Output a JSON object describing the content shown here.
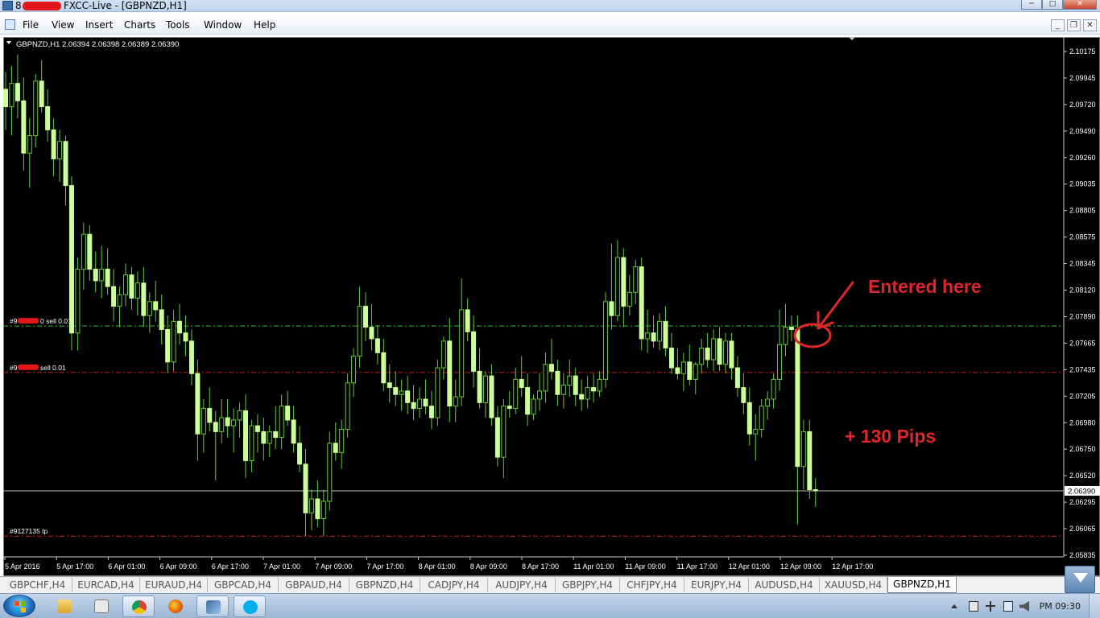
{
  "window": {
    "title_prefix": "8",
    "title_text": "FXCC-Live - [GBPNZD,H1]",
    "minimize": "─",
    "maximize": "□",
    "close": "✕"
  },
  "menu": {
    "items": [
      "File",
      "View",
      "Insert",
      "Charts",
      "Tools",
      "Window",
      "Help"
    ],
    "mdi_buttons": [
      "_",
      "❐",
      "✕"
    ]
  },
  "chart": {
    "header": "GBPNZD,H1  2.06394 2.06398 2.06389 2.06390",
    "price_ticks": [
      "2.10175",
      "2.09945",
      "2.09720",
      "2.09490",
      "2.09260",
      "2.09035",
      "2.08805",
      "2.08575",
      "2.08345",
      "2.08120",
      "2.07890",
      "2.07665",
      "2.07435",
      "2.07205",
      "2.06980",
      "2.06750",
      "2.06520",
      "2.06295",
      "2.06065",
      "2.05835"
    ],
    "time_ticks": [
      "5 Apr 2016",
      "5 Apr 17:00",
      "6 Apr 01:00",
      "6 Apr 09:00",
      "6 Apr 17:00",
      "7 Apr 01:00",
      "7 Apr 09:00",
      "7 Apr 17:00",
      "8 Apr 01:00",
      "8 Apr 09:00",
      "8 Apr 17:00",
      "11 Apr 01:00",
      "11 Apr 09:00",
      "11 Apr 17:00",
      "12 Apr 01:00",
      "12 Apr 09:00",
      "12 Apr 17:00"
    ],
    "current_price": "2.06390",
    "order_lines": [
      {
        "label_prefix": "#9",
        "label_suffix": "0 sell 0.01",
        "color": "#34c234",
        "price": 2.0781
      },
      {
        "label_prefix": "#9",
        "label_suffix": "sell 0.01",
        "color": "#d42020",
        "price": 2.0741
      },
      {
        "label_prefix": "#9127135 tp",
        "label_suffix": "",
        "color": "#d42020",
        "price": 2.06
      }
    ],
    "annotations": {
      "entered": "Entered here",
      "pips": "+ 130 Pips",
      "color": "#e0262b"
    },
    "candle_color": "#ccff99",
    "wick_color": "#66cc33"
  },
  "chart_data": {
    "type": "candlestick",
    "title": "GBPNZD,H1",
    "ylim": [
      2.05835,
      2.10175
    ],
    "candles": [
      [
        2.0985,
        2.1,
        2.095,
        2.097
      ],
      [
        2.097,
        2.1005,
        2.0945,
        2.099
      ],
      [
        2.099,
        2.1015,
        2.096,
        2.0975
      ],
      [
        2.0975,
        2.0995,
        2.0915,
        2.093
      ],
      [
        2.093,
        2.096,
        2.09,
        2.0945
      ],
      [
        2.0945,
        2.0998,
        2.0935,
        2.0992
      ],
      [
        2.0992,
        2.101,
        2.0965,
        2.097
      ],
      [
        2.097,
        2.0985,
        2.094,
        2.095
      ],
      [
        2.095,
        2.096,
        2.091,
        2.0925
      ],
      [
        2.0925,
        2.095,
        2.0905,
        2.094
      ],
      [
        2.094,
        2.0945,
        2.0885,
        2.0902
      ],
      [
        2.0902,
        2.091,
        2.076,
        2.0775
      ],
      [
        2.0775,
        2.084,
        2.076,
        2.083
      ],
      [
        2.083,
        2.087,
        2.0812,
        2.086
      ],
      [
        2.086,
        2.0868,
        2.082,
        2.083
      ],
      [
        2.083,
        2.0845,
        2.081,
        2.082
      ],
      [
        2.082,
        2.085,
        2.0805,
        2.083
      ],
      [
        2.083,
        2.0848,
        2.0808,
        2.0815
      ],
      [
        2.0815,
        2.083,
        2.0785,
        2.0798
      ],
      [
        2.0798,
        2.0815,
        2.078,
        2.0808
      ],
      [
        2.0808,
        2.0835,
        2.0798,
        2.0825
      ],
      [
        2.0825,
        2.0832,
        2.0795,
        2.0805
      ],
      [
        2.0805,
        2.0828,
        2.079,
        2.0818
      ],
      [
        2.0818,
        2.0832,
        2.078,
        2.079
      ],
      [
        2.079,
        2.081,
        2.0775,
        2.0802
      ],
      [
        2.0802,
        2.082,
        2.0785,
        2.0795
      ],
      [
        2.0795,
        2.0808,
        2.0765,
        2.0778
      ],
      [
        2.0778,
        2.079,
        2.074,
        2.075
      ],
      [
        2.075,
        2.0795,
        2.0742,
        2.0785
      ],
      [
        2.0785,
        2.08,
        2.0765,
        2.0775
      ],
      [
        2.0775,
        2.079,
        2.0755,
        2.0768
      ],
      [
        2.0768,
        2.0778,
        2.073,
        2.074
      ],
      [
        2.074,
        2.0752,
        2.0665,
        2.0688
      ],
      [
        2.0688,
        2.0718,
        2.0672,
        2.071
      ],
      [
        2.071,
        2.0728,
        2.069,
        2.0698
      ],
      [
        2.0698,
        2.0708,
        2.0648,
        2.069
      ],
      [
        2.069,
        2.0718,
        2.068,
        2.0702
      ],
      [
        2.0702,
        2.0718,
        2.0685,
        2.0695
      ],
      [
        2.0695,
        2.071,
        2.0672,
        2.07
      ],
      [
        2.07,
        2.0715,
        2.0685,
        2.0708
      ],
      [
        2.0708,
        2.0722,
        2.065,
        2.0665
      ],
      [
        2.0665,
        2.07,
        2.0655,
        2.0695
      ],
      [
        2.0695,
        2.0705,
        2.0672,
        2.069
      ],
      [
        2.069,
        2.0702,
        2.0665,
        2.068
      ],
      [
        2.068,
        2.0695,
        2.0668,
        2.069
      ],
      [
        2.069,
        2.0712,
        2.0675,
        2.0685
      ],
      [
        2.0685,
        2.0722,
        2.0675,
        2.0712
      ],
      [
        2.0712,
        2.0725,
        2.0695,
        2.07
      ],
      [
        2.07,
        2.0712,
        2.0672,
        2.068
      ],
      [
        2.068,
        2.0695,
        2.0655,
        2.0662
      ],
      [
        2.0662,
        2.0675,
        2.06,
        2.062
      ],
      [
        2.062,
        2.064,
        2.0605,
        2.0632
      ],
      [
        2.0632,
        2.0648,
        2.0608,
        2.0615
      ],
      [
        2.0615,
        2.064,
        2.06,
        2.063
      ],
      [
        2.063,
        2.069,
        2.0622,
        2.068
      ],
      [
        2.068,
        2.0698,
        2.0665,
        2.0672
      ],
      [
        2.0672,
        2.07,
        2.0658,
        2.0692
      ],
      [
        2.0692,
        2.074,
        2.0685,
        2.0732
      ],
      [
        2.0732,
        2.0762,
        2.072,
        2.0755
      ],
      [
        2.0755,
        2.0815,
        2.0745,
        2.0798
      ],
      [
        2.0798,
        2.081,
        2.0768,
        2.078
      ],
      [
        2.078,
        2.08,
        2.076,
        2.077
      ],
      [
        2.077,
        2.0782,
        2.0748,
        2.0758
      ],
      [
        2.0758,
        2.077,
        2.0725,
        2.0732
      ],
      [
        2.0732,
        2.0748,
        2.0715,
        2.0728
      ],
      [
        2.0728,
        2.0742,
        2.0712,
        2.0722
      ],
      [
        2.0722,
        2.0735,
        2.0708,
        2.0725
      ],
      [
        2.0725,
        2.0738,
        2.0705,
        2.0715
      ],
      [
        2.0715,
        2.073,
        2.07,
        2.071
      ],
      [
        2.071,
        2.0728,
        2.0702,
        2.0718
      ],
      [
        2.0718,
        2.0735,
        2.0705,
        2.0712
      ],
      [
        2.0712,
        2.0725,
        2.0692,
        2.0702
      ],
      [
        2.0702,
        2.0752,
        2.0695,
        2.0745
      ],
      [
        2.0745,
        2.0772,
        2.0735,
        2.0768
      ],
      [
        2.0768,
        2.0788,
        2.0698,
        2.0712
      ],
      [
        2.0712,
        2.0735,
        2.0698,
        2.072
      ],
      [
        2.072,
        2.0822,
        2.0712,
        2.0795
      ],
      [
        2.0795,
        2.0805,
        2.0768,
        2.0776
      ],
      [
        2.0776,
        2.079,
        2.0728,
        2.0742
      ],
      [
        2.0742,
        2.0762,
        2.071,
        2.0715
      ],
      [
        2.0715,
        2.0742,
        2.0702,
        2.0738
      ],
      [
        2.0738,
        2.0748,
        2.0695,
        2.0702
      ],
      [
        2.0702,
        2.0712,
        2.066,
        2.0668
      ],
      [
        2.0668,
        2.0718,
        2.065,
        2.0712
      ],
      [
        2.0712,
        2.0725,
        2.0702,
        2.071
      ],
      [
        2.071,
        2.0745,
        2.0705,
        2.0735
      ],
      [
        2.0735,
        2.0755,
        2.072,
        2.0728
      ],
      [
        2.0728,
        2.074,
        2.0695,
        2.0705
      ],
      [
        2.0705,
        2.0722,
        2.07,
        2.0718
      ],
      [
        2.0718,
        2.074,
        2.0708,
        2.0725
      ],
      [
        2.0725,
        2.0758,
        2.0715,
        2.0748
      ],
      [
        2.0748,
        2.077,
        2.0735,
        2.0742
      ],
      [
        2.0742,
        2.0752,
        2.0712,
        2.0722
      ],
      [
        2.0722,
        2.074,
        2.071,
        2.073
      ],
      [
        2.073,
        2.0752,
        2.072,
        2.0738
      ],
      [
        2.0738,
        2.0745,
        2.0712,
        2.0722
      ],
      [
        2.0722,
        2.0735,
        2.0708,
        2.0718
      ],
      [
        2.0718,
        2.0738,
        2.071,
        2.0728
      ],
      [
        2.0728,
        2.074,
        2.0715,
        2.0725
      ],
      [
        2.0725,
        2.0742,
        2.072,
        2.0735
      ],
      [
        2.0735,
        2.081,
        2.0728,
        2.0802
      ],
      [
        2.0802,
        2.0852,
        2.0778,
        2.079
      ],
      [
        2.079,
        2.0855,
        2.0785,
        2.084
      ],
      [
        2.084,
        2.0848,
        2.078,
        2.0798
      ],
      [
        2.0798,
        2.0825,
        2.079,
        2.081
      ],
      [
        2.081,
        2.0838,
        2.08,
        2.0832
      ],
      [
        2.0832,
        2.084,
        2.076,
        2.077
      ],
      [
        2.077,
        2.0795,
        2.0758,
        2.0775
      ],
      [
        2.0775,
        2.079,
        2.0762,
        2.0768
      ],
      [
        2.0768,
        2.0792,
        2.076,
        2.0785
      ],
      [
        2.0785,
        2.0798,
        2.0755,
        2.0762
      ],
      [
        2.0762,
        2.0775,
        2.074,
        2.0745
      ],
      [
        2.0745,
        2.0762,
        2.0735,
        2.074
      ],
      [
        2.074,
        2.0758,
        2.0725,
        2.075
      ],
      [
        2.075,
        2.0765,
        2.073,
        2.0735
      ],
      [
        2.0735,
        2.075,
        2.0722,
        2.0748
      ],
      [
        2.0748,
        2.077,
        2.074,
        2.0762
      ],
      [
        2.0762,
        2.0775,
        2.0745,
        2.0752
      ],
      [
        2.0752,
        2.0778,
        2.0742,
        2.077
      ],
      [
        2.077,
        2.078,
        2.0742,
        2.0748
      ],
      [
        2.0748,
        2.0775,
        2.074,
        2.0768
      ],
      [
        2.0768,
        2.0775,
        2.0735,
        2.0745
      ],
      [
        2.0745,
        2.0755,
        2.072,
        2.0728
      ],
      [
        2.0728,
        2.074,
        2.0705,
        2.0715
      ],
      [
        2.0715,
        2.0728,
        2.0678,
        2.0688
      ],
      [
        2.0688,
        2.0705,
        2.0665,
        2.0692
      ],
      [
        2.0692,
        2.0718,
        2.0685,
        2.0712
      ],
      [
        2.0712,
        2.0725,
        2.07,
        2.0718
      ],
      [
        2.0718,
        2.074,
        2.071,
        2.0735
      ],
      [
        2.0735,
        2.0795,
        2.0725,
        2.0765
      ],
      [
        2.0765,
        2.08,
        2.0755,
        2.078
      ],
      [
        2.078,
        2.079,
        2.0768,
        2.0778
      ],
      [
        2.0778,
        2.079,
        2.061,
        2.066
      ],
      [
        2.066,
        2.07,
        2.064,
        2.069
      ],
      [
        2.069,
        2.07,
        2.0632,
        2.064
      ],
      [
        2.064,
        2.065,
        2.0625,
        2.0639
      ]
    ]
  },
  "tabs": [
    "GBPCHF,H4",
    "EURCAD,H4",
    "EURAUD,H4",
    "GBPCAD,H4",
    "GBPAUD,H4",
    "GBPNZD,H4",
    "CADJPY,H4",
    "AUDJPY,H4",
    "GBPJPY,H4",
    "CHFJPY,H4",
    "EURJPY,H4",
    "AUDUSD,H4",
    "XAUUSD,H4",
    "GBPNZD,H1"
  ],
  "active_tab": "GBPNZD,H1",
  "taskbar": {
    "clock": "PM 09:30",
    "apps": [
      "explorer-icon",
      "calculator-icon",
      "chrome-icon",
      "firefox-icon",
      "metatrader-icon",
      "skype-icon"
    ]
  }
}
